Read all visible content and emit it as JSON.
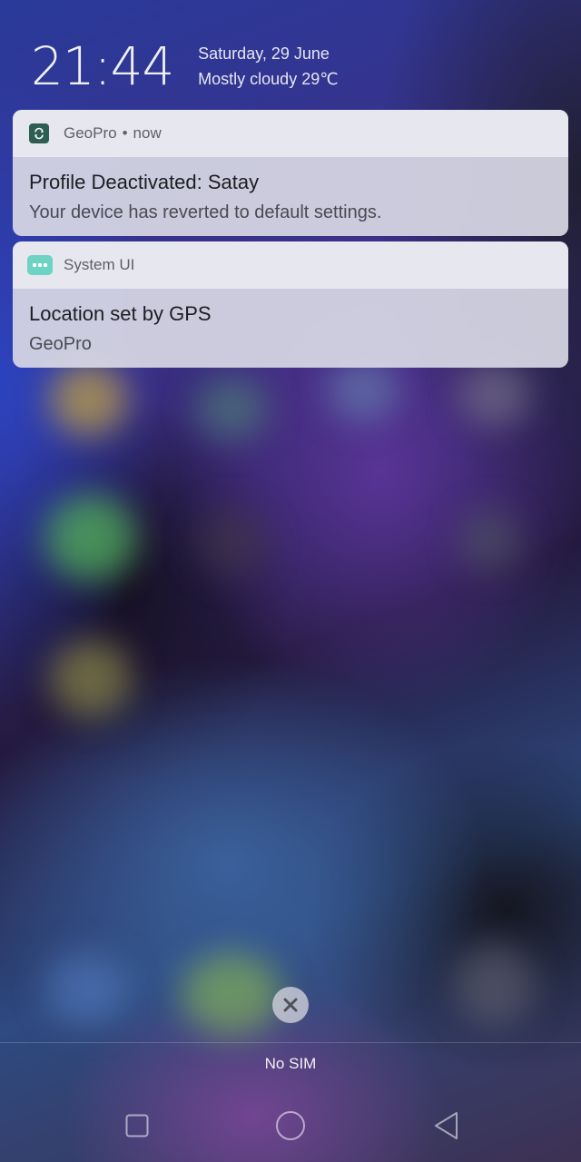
{
  "lockscreen": {
    "time": "21:44",
    "date": "Saturday, 29 June",
    "weather": "Mostly cloudy 29℃"
  },
  "notifications": [
    {
      "app": "GeoPro",
      "separator": "•",
      "when": "now",
      "icon": "geopro-app-icon",
      "title": "Profile Deactivated: Satay",
      "text": "Your device has reverted to default settings."
    },
    {
      "app": "System UI",
      "icon": "system-ui-app-icon",
      "title": "Location set by GPS",
      "text": "GeoPro"
    }
  ],
  "footer": {
    "carrier": "No SIM",
    "dismiss_icon": "close-icon"
  },
  "navbar": {
    "recent_icon": "square-icon",
    "home_icon": "circle-icon",
    "back_icon": "triangle-back-icon"
  },
  "colors": {
    "geopro_icon": "#2e5d51",
    "system_ui_icon": "#6fd3c3",
    "card_background": "#d7d7e4"
  }
}
